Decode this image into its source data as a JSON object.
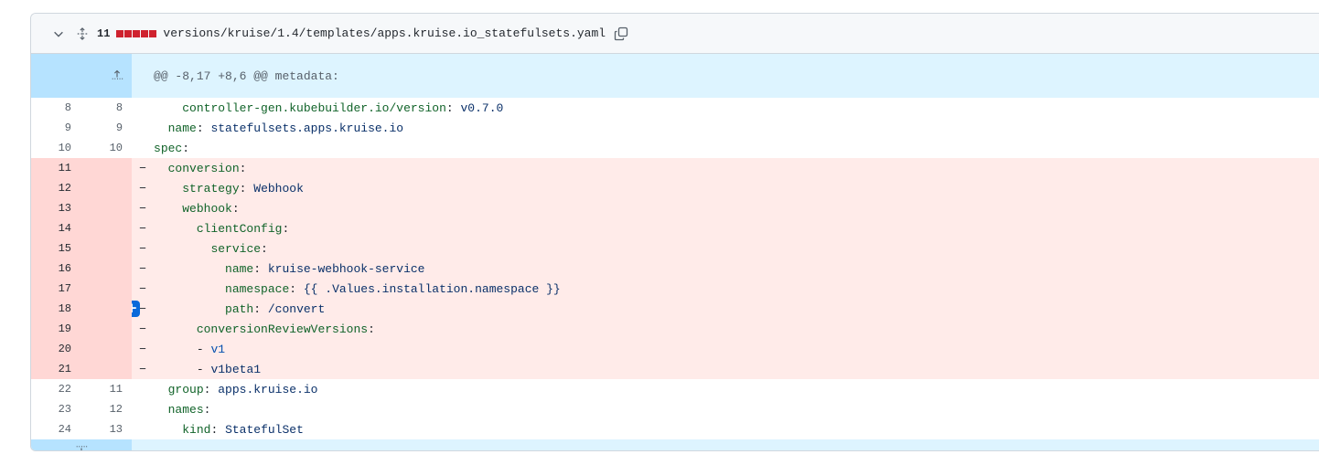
{
  "file": {
    "changes": "11",
    "path": "versions/kruise/1.4/templates/apps.kruise.io_statefulsets.yaml",
    "diffstat_colors": [
      "#cf222e",
      "#cf222e",
      "#cf222e",
      "#cf222e",
      "#cf222e"
    ],
    "icons": {
      "collapse": "chevron-down-icon",
      "expand": "unfold-icon",
      "copy": "copy-icon"
    }
  },
  "hunk": {
    "header": "@@ -8,17 +8,6 @@ metadata:"
  },
  "lines": [
    {
      "type": "ctx",
      "old": "8",
      "new": "8",
      "indent": "    ",
      "key": "controller-gen.kubebuilder.io/version",
      "sep": ": ",
      "val": "v0.7.0"
    },
    {
      "type": "ctx",
      "old": "9",
      "new": "9",
      "indent": "  ",
      "key": "name",
      "sep": ": ",
      "val": "statefulsets.apps.kruise.io"
    },
    {
      "type": "ctx",
      "old": "10",
      "new": "10",
      "indent": "",
      "key": "spec",
      "sep": ":",
      "val": ""
    },
    {
      "type": "del",
      "old": "11",
      "new": "",
      "indent": "  ",
      "key": "conversion",
      "sep": ":",
      "val": ""
    },
    {
      "type": "del",
      "old": "12",
      "new": "",
      "indent": "    ",
      "key": "strategy",
      "sep": ": ",
      "val": "Webhook"
    },
    {
      "type": "del",
      "old": "13",
      "new": "",
      "indent": "    ",
      "key": "webhook",
      "sep": ":",
      "val": ""
    },
    {
      "type": "del",
      "old": "14",
      "new": "",
      "indent": "      ",
      "key": "clientConfig",
      "sep": ":",
      "val": ""
    },
    {
      "type": "del",
      "old": "15",
      "new": "",
      "indent": "        ",
      "key": "service",
      "sep": ":",
      "val": ""
    },
    {
      "type": "del",
      "old": "16",
      "new": "",
      "indent": "          ",
      "key": "name",
      "sep": ": ",
      "val": "kruise-webhook-service"
    },
    {
      "type": "del",
      "old": "17",
      "new": "",
      "indent": "          ",
      "key": "namespace",
      "sep": ": ",
      "val": "{{ .Values.installation.namespace }}"
    },
    {
      "type": "del",
      "old": "18",
      "new": "",
      "indent": "          ",
      "key": "path",
      "sep": ": ",
      "val": "/convert",
      "comment_button": true
    },
    {
      "type": "del",
      "old": "19",
      "new": "",
      "indent": "      ",
      "key": "conversionReviewVersions",
      "sep": ":",
      "val": ""
    },
    {
      "type": "del",
      "old": "20",
      "new": "",
      "indent": "      ",
      "key": "",
      "sep": "- ",
      "val": "v1",
      "val_class": "sv"
    },
    {
      "type": "del",
      "old": "21",
      "new": "",
      "indent": "      ",
      "key": "",
      "sep": "- ",
      "val": "v1beta1"
    },
    {
      "type": "ctx",
      "old": "22",
      "new": "11",
      "indent": "  ",
      "key": "group",
      "sep": ": ",
      "val": "apps.kruise.io"
    },
    {
      "type": "ctx",
      "old": "23",
      "new": "12",
      "indent": "  ",
      "key": "names",
      "sep": ":",
      "val": ""
    },
    {
      "type": "ctx",
      "old": "24",
      "new": "13",
      "indent": "    ",
      "key": "kind",
      "sep": ": ",
      "val": "StatefulSet"
    }
  ],
  "markers": {
    "del": "−",
    "ctx": " "
  },
  "comment_button_label": "+"
}
